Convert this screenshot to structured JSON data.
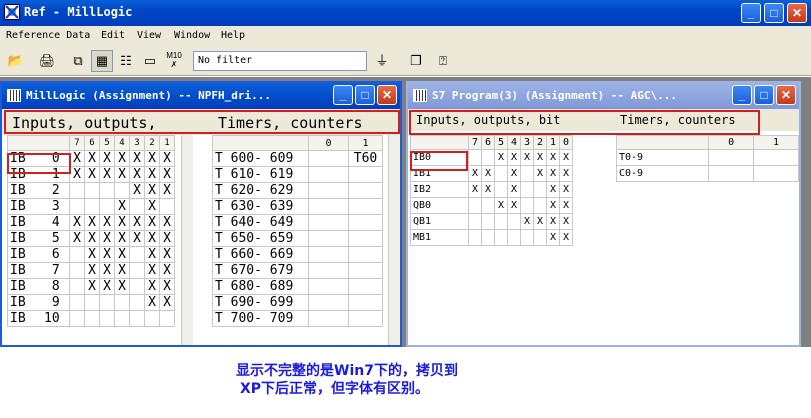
{
  "app": {
    "title": "Ref - MillLogic"
  },
  "menu": [
    "Reference Data",
    "Edit",
    "View",
    "Window",
    "Help"
  ],
  "toolbar": {
    "filter_value": "No filter"
  },
  "left_window": {
    "title": "MillLogic (Assignment) -- NPFH_dri...",
    "header_io": "Inputs, outputs,",
    "header_timers": "Timers, counters",
    "bit_headers": [
      "7",
      "6",
      "5",
      "4",
      "3",
      "2",
      "1"
    ],
    "rows": [
      {
        "name": "IB",
        "num": "0",
        "bits": [
          "X",
          "X",
          "X",
          "X",
          "X",
          "X",
          "X"
        ]
      },
      {
        "name": "IB",
        "num": "1",
        "bits": [
          "X",
          "X",
          "X",
          "X",
          "X",
          "X",
          "X"
        ]
      },
      {
        "name": "IB",
        "num": "2",
        "bits": [
          "",
          "",
          "",
          "",
          "X",
          "X",
          "X"
        ]
      },
      {
        "name": "IB",
        "num": "3",
        "bits": [
          "",
          "",
          "",
          "X",
          "",
          "X",
          ""
        ]
      },
      {
        "name": "IB",
        "num": "4",
        "bits": [
          "X",
          "X",
          "X",
          "X",
          "X",
          "X",
          "X"
        ]
      },
      {
        "name": "IB",
        "num": "5",
        "bits": [
          "X",
          "X",
          "X",
          "X",
          "X",
          "X",
          "X"
        ]
      },
      {
        "name": "IB",
        "num": "6",
        "bits": [
          "",
          "X",
          "X",
          "X",
          "",
          "X",
          "X"
        ]
      },
      {
        "name": "IB",
        "num": "7",
        "bits": [
          "",
          "X",
          "X",
          "X",
          "",
          "X",
          "X"
        ]
      },
      {
        "name": "IB",
        "num": "8",
        "bits": [
          "",
          "X",
          "X",
          "X",
          "",
          "X",
          "X"
        ]
      },
      {
        "name": "IB",
        "num": "9",
        "bits": [
          "",
          "",
          "",
          "",
          "",
          "X",
          "X"
        ]
      },
      {
        "name": "IB",
        "num": "10",
        "bits": [
          "",
          "",
          "",
          "",
          "",
          "",
          ""
        ]
      }
    ],
    "timer_headers": [
      "0",
      "1"
    ],
    "timer_rows": [
      {
        "label": "T 600- 609",
        "v0": "",
        "v1": "T60"
      },
      {
        "label": "T 610- 619",
        "v0": "",
        "v1": ""
      },
      {
        "label": "T 620- 629",
        "v0": "",
        "v1": ""
      },
      {
        "label": "T 630- 639",
        "v0": "",
        "v1": ""
      },
      {
        "label": "T 640- 649",
        "v0": "",
        "v1": ""
      },
      {
        "label": "T 650- 659",
        "v0": "",
        "v1": ""
      },
      {
        "label": "T 660- 669",
        "v0": "",
        "v1": ""
      },
      {
        "label": "T 670- 679",
        "v0": "",
        "v1": ""
      },
      {
        "label": "T 680- 689",
        "v0": "",
        "v1": ""
      },
      {
        "label": "T 690- 699",
        "v0": "",
        "v1": ""
      },
      {
        "label": "T 700- 709",
        "v0": "",
        "v1": ""
      }
    ]
  },
  "right_window": {
    "title": "S7 Program(3) (Assignment) -- AGC\\...",
    "header_io": "Inputs, outputs, bit",
    "header_timers": "Timers, counters",
    "bit_headers": [
      "7",
      "6",
      "5",
      "4",
      "3",
      "2",
      "1",
      "0"
    ],
    "rows": [
      {
        "name": "IB0",
        "bits": [
          "",
          "",
          "X",
          "X",
          "X",
          "X",
          "X",
          "X"
        ]
      },
      {
        "name": "IB1",
        "bits": [
          "X",
          "X",
          "",
          "X",
          "",
          "X",
          "X",
          "X"
        ]
      },
      {
        "name": "IB2",
        "bits": [
          "X",
          "X",
          "",
          "X",
          "",
          "",
          "X",
          "X"
        ]
      },
      {
        "name": "QB0",
        "bits": [
          "",
          "",
          "X",
          "X",
          "",
          "",
          "X",
          "X"
        ]
      },
      {
        "name": "QB1",
        "bits": [
          "",
          "",
          "",
          "",
          "X",
          "X",
          "X",
          "X"
        ]
      },
      {
        "name": "MB1",
        "bits": [
          "",
          "",
          "",
          "",
          "",
          "",
          "X",
          "X"
        ]
      }
    ],
    "timer_headers": [
      "0",
      "1"
    ],
    "timer_rows": [
      {
        "label": "T0-9",
        "v0": "",
        "v1": ""
      },
      {
        "label": "C0-9",
        "v0": "",
        "v1": ""
      }
    ]
  },
  "note": {
    "line1": "显示不完整的是Win7下的，拷贝到",
    "line2": "XP下后正常，但字体有区别。"
  },
  "colors": {
    "accent": "#0046c7",
    "highlight": "#d21e1e",
    "note": "#1a1ae0"
  }
}
